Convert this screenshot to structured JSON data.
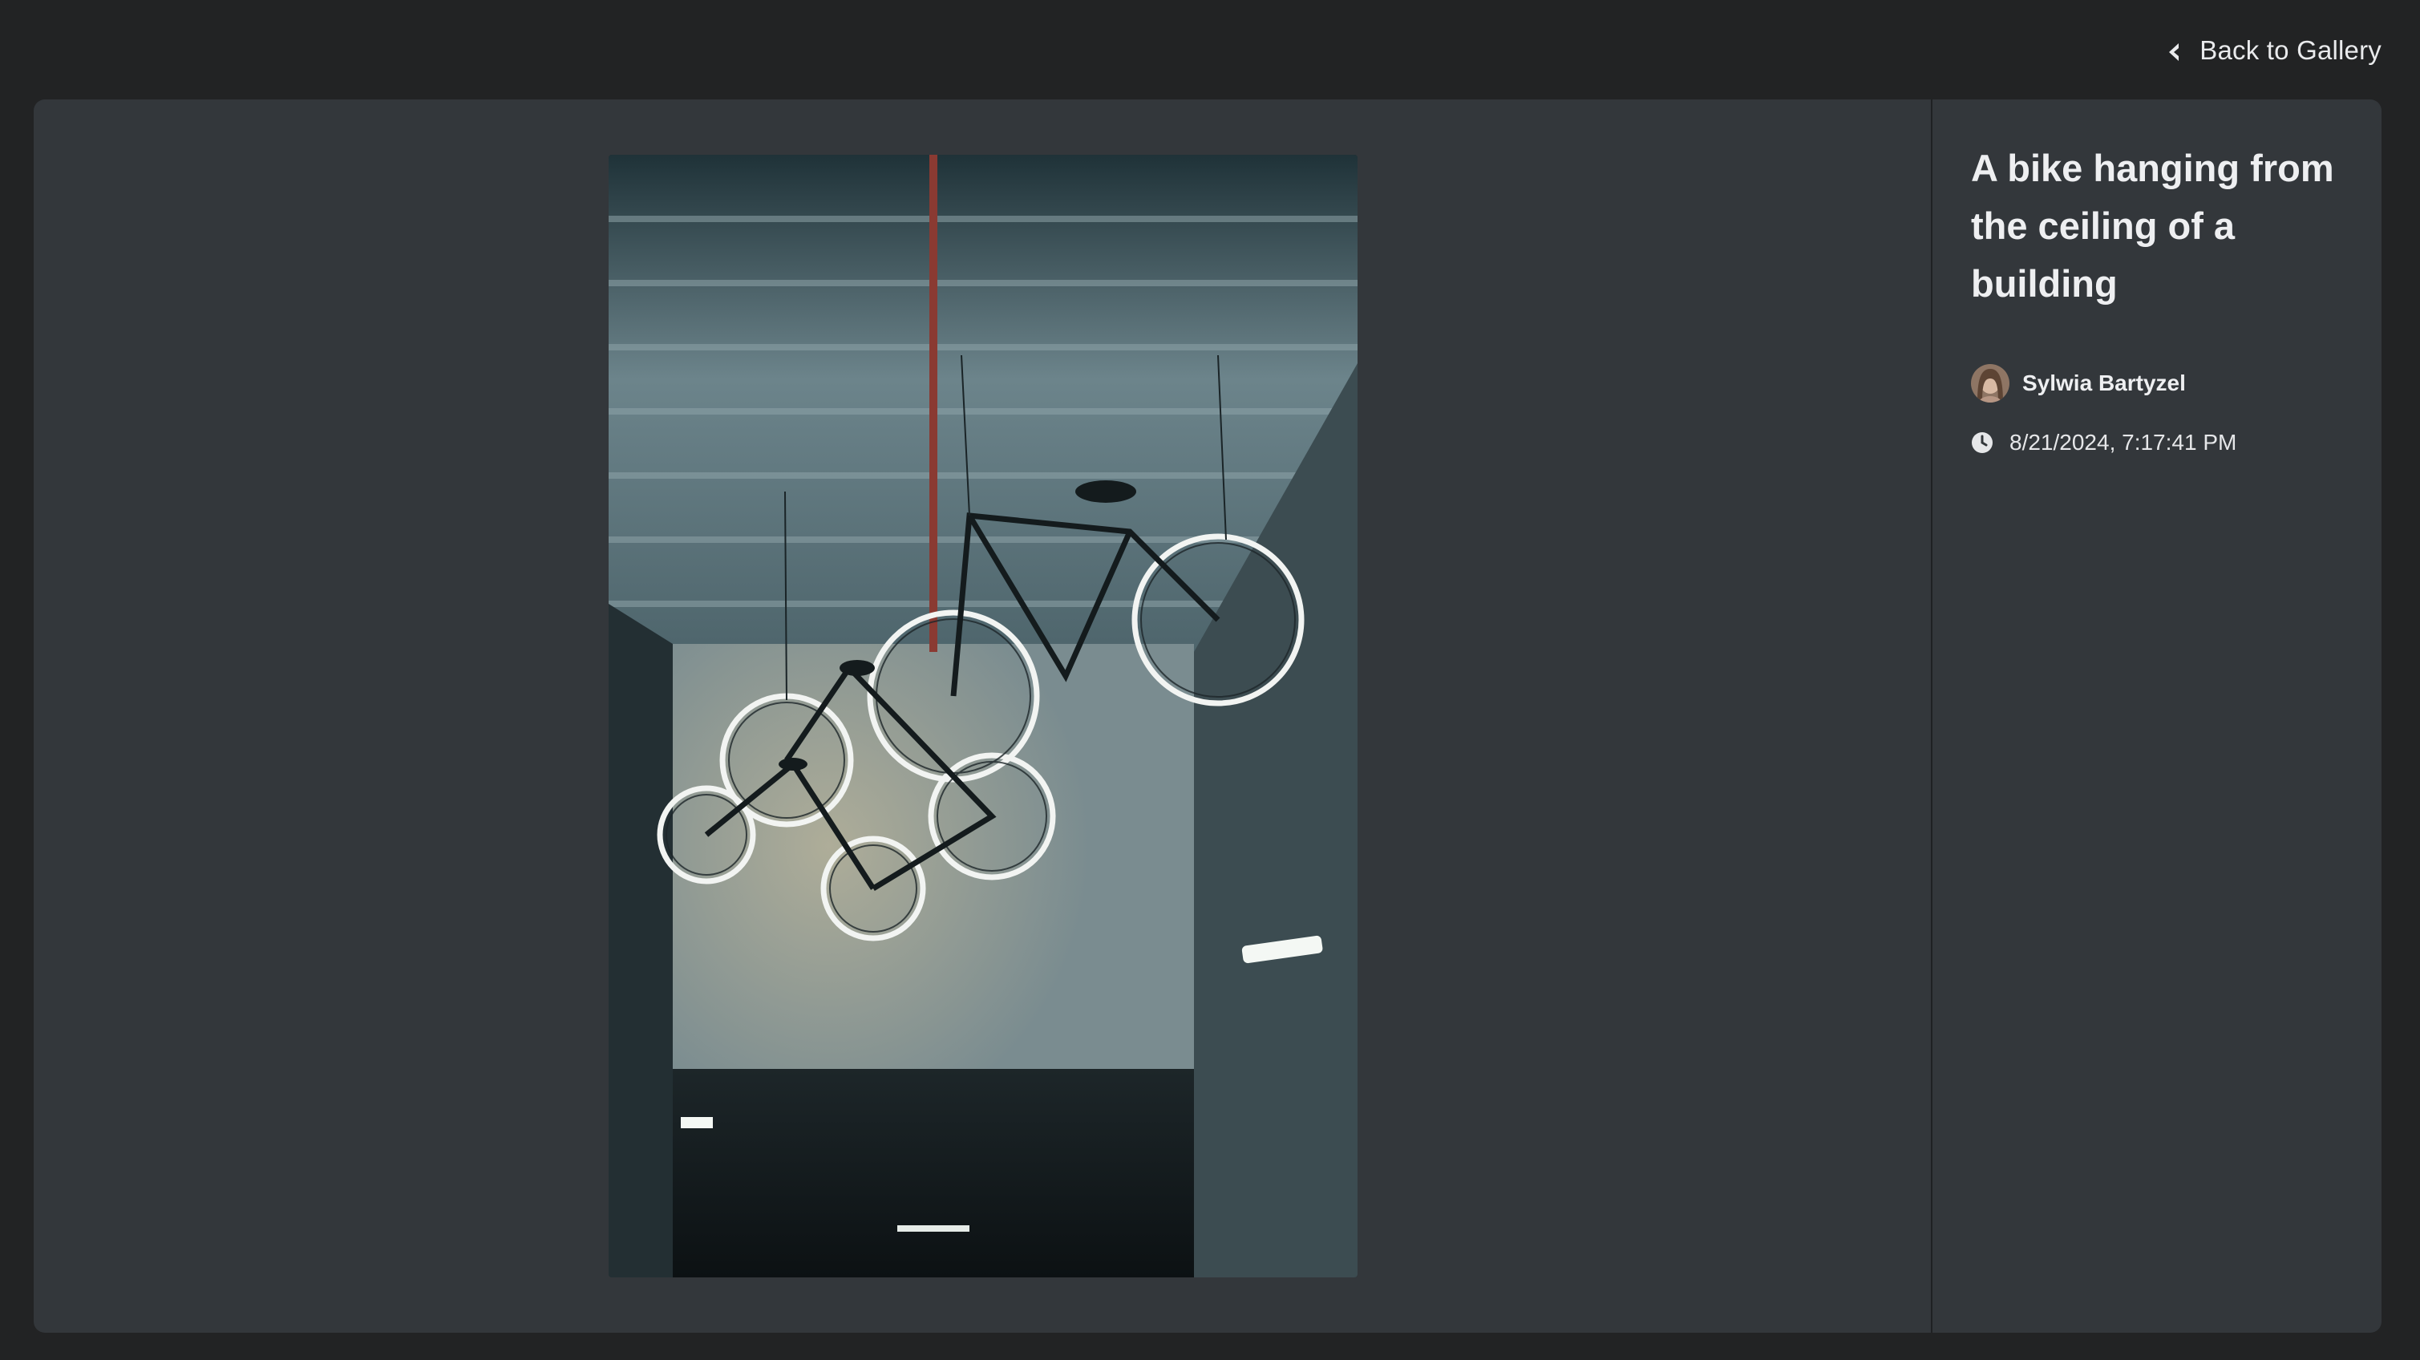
{
  "nav": {
    "back_label": "Back to Gallery",
    "back_icon": "chevron-left-icon"
  },
  "photo": {
    "alt": "A bike hanging from the ceiling of a building"
  },
  "details": {
    "title": "A bike hanging from the ceiling of a building",
    "author": "Sylwia Bartyzel",
    "date": "8/21/2024, 7:17:41 PM",
    "date_icon": "clock-icon"
  },
  "colors": {
    "page_bg": "#222324",
    "panel_bg": "#33373b",
    "text": "#eeeff1"
  }
}
